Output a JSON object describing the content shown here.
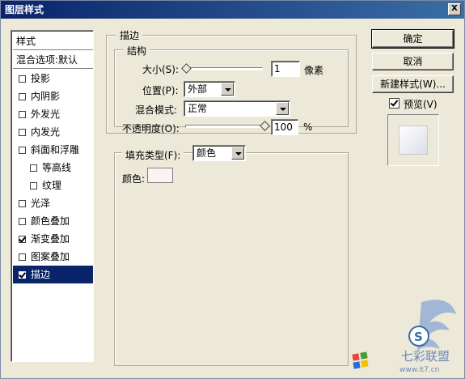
{
  "window": {
    "title": "图层样式",
    "close_label": "X"
  },
  "left_list": {
    "header": "样式",
    "blend_options": "混合选项:默认",
    "items": [
      {
        "label": "投影",
        "checked": false
      },
      {
        "label": "内阴影",
        "checked": false
      },
      {
        "label": "外发光",
        "checked": false
      },
      {
        "label": "内发光",
        "checked": false
      },
      {
        "label": "斜面和浮雕",
        "checked": false
      },
      {
        "label": "等高线",
        "checked": false
      },
      {
        "label": "纹理",
        "checked": false
      },
      {
        "label": "光泽",
        "checked": false
      },
      {
        "label": "颜色叠加",
        "checked": false
      },
      {
        "label": "渐变叠加",
        "checked": true
      },
      {
        "label": "图案叠加",
        "checked": false
      },
      {
        "label": "描边",
        "checked": true
      }
    ]
  },
  "stroke": {
    "group_title": "描边",
    "structure_title": "结构",
    "size_label": "大小(S):",
    "size_value": "1",
    "size_unit": "像素",
    "position_label": "位置(P):",
    "position_value": "外部",
    "blend_mode_label": "混合模式:",
    "blend_mode_value": "正常",
    "opacity_label": "不透明度(O):",
    "opacity_value": "100",
    "opacity_unit": "%",
    "fill_type_label": "填充类型(F):",
    "fill_type_value": "颜色",
    "color_label": "颜色:",
    "color_value": "#fdf2f2"
  },
  "buttons": {
    "ok": "确定",
    "cancel": "取消",
    "new_style": "新建样式(W)...",
    "preview_label": "预览(V)"
  },
  "watermark": {
    "text": "七彩联盟",
    "url": "www.it7.cn"
  }
}
